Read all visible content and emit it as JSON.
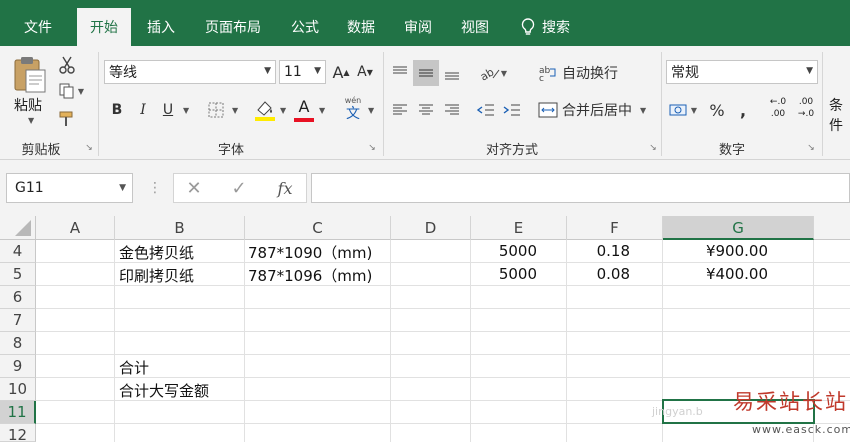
{
  "menu": {
    "tabs": [
      "文件",
      "开始",
      "插入",
      "页面布局",
      "公式",
      "数据",
      "审阅",
      "视图",
      "搜索"
    ],
    "active": "开始"
  },
  "ribbon": {
    "clipboard": {
      "paste_label": "粘贴",
      "group_label": "剪贴板"
    },
    "font": {
      "name": "等线",
      "size": "11",
      "bold": "B",
      "italic": "I",
      "underline": "U",
      "grow": "A",
      "shrink": "A",
      "color_letter": "A",
      "phonetic_top": "wén",
      "phonetic_bottom": "文",
      "group_label": "字体",
      "fill_color": "#ffeb00",
      "font_color": "#e81123"
    },
    "alignment": {
      "wrap_label": "自动换行",
      "merge_label": "合并后居中",
      "group_label": "对齐方式"
    },
    "number": {
      "format": "常规",
      "percent": "%",
      "comma": ",",
      "dec_inc": ".00",
      "dec_dec": ".0",
      "group_label": "数字"
    },
    "styles": {
      "partial_label": "条件"
    }
  },
  "formula_bar": {
    "name_box": "G11",
    "fx": "fx",
    "content": ""
  },
  "grid": {
    "columns": [
      "A",
      "B",
      "C",
      "D",
      "E",
      "F",
      "G"
    ],
    "selected_column": "G",
    "rows": [
      "4",
      "5",
      "6",
      "7",
      "8",
      "9",
      "10",
      "11",
      "12"
    ],
    "selected_row": "11",
    "cells": {
      "r4": {
        "b": "金色拷贝纸",
        "c": "787*1090（mm)",
        "e": "5000",
        "f": "0.18",
        "g": "¥900.00"
      },
      "r5": {
        "b": "印刷拷贝纸",
        "c": "787*1096（mm)",
        "e": "5000",
        "f": "0.08",
        "g": "¥400.00"
      },
      "r9": {
        "b": "合计"
      },
      "r10": {
        "b": "合计大写金额"
      }
    }
  },
  "watermark": {
    "text": "易采站长站",
    "url": "www.easck.com",
    "faint": "jingyan.b"
  },
  "colors": {
    "excel_green": "#217346"
  }
}
